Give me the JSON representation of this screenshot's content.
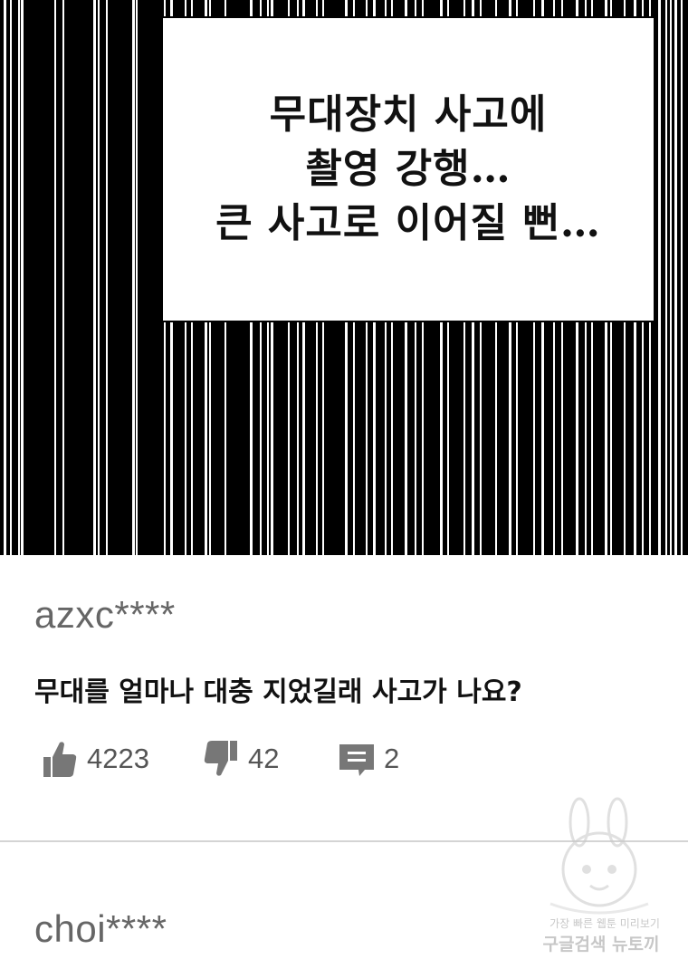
{
  "panel": {
    "caption_lines": [
      "무대장치 사고에",
      "촬영 강행…",
      "큰 사고로 이어질 뻔…"
    ],
    "colors": {
      "background": "#000000",
      "stripe": "#ffffff",
      "box": "#ffffff"
    }
  },
  "comments": [
    {
      "username": "azxc****",
      "text": "무대를 얼마나 대충 지었길래 사고가 나요?",
      "likes": "4223",
      "dislikes": "42",
      "replies": "2"
    },
    {
      "username": "choi****"
    }
  ],
  "icons": {
    "like": "thumbs-up-icon",
    "dislike": "thumbs-down-icon",
    "reply": "comment-icon"
  },
  "watermark": {
    "line1": "가장 빠른 웹툰 미리보기",
    "line2": "구글검색 뉴토끼"
  },
  "colors": {
    "username": "#666666",
    "icon": "#777777",
    "divider": "#d4d4d4"
  }
}
